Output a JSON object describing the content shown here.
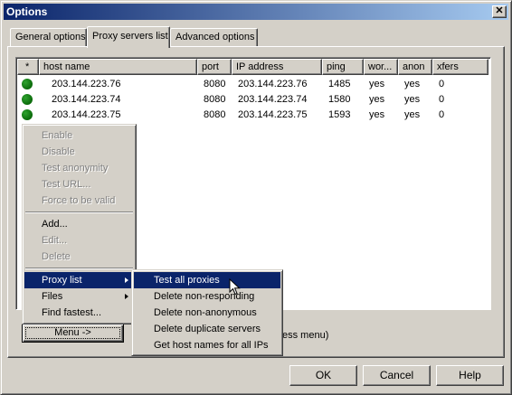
{
  "window": {
    "title": "Options",
    "close_label": "✕"
  },
  "tabs": [
    {
      "label": "General options",
      "active": false
    },
    {
      "label": "Proxy servers list",
      "active": true
    },
    {
      "label": "Advanced options",
      "active": false
    }
  ],
  "table": {
    "columns": [
      "*",
      "host name",
      "port",
      "IP address",
      "ping",
      "wor...",
      "anon",
      "xfers"
    ],
    "rows": [
      {
        "status": "green",
        "host": "203.144.223.76",
        "port": "8080",
        "ip": "203.144.223.76",
        "ping": "1485",
        "wor": "yes",
        "anon": "yes",
        "xfers": "0"
      },
      {
        "status": "green",
        "host": "203.144.223.74",
        "port": "8080",
        "ip": "203.144.223.74",
        "ping": "1580",
        "wor": "yes",
        "anon": "yes",
        "xfers": "0"
      },
      {
        "status": "green",
        "host": "203.144.223.75",
        "port": "8080",
        "ip": "203.144.223.75",
        "ping": "1593",
        "wor": "yes",
        "anon": "yes",
        "xfers": "0"
      }
    ],
    "status_color": "#0a7a0a"
  },
  "context_menu": {
    "items": [
      {
        "label": "Enable",
        "disabled": true
      },
      {
        "label": "Disable",
        "disabled": true
      },
      {
        "label": "Test anonymity",
        "disabled": true
      },
      {
        "label": "Test URL...",
        "disabled": true
      },
      {
        "label": "Force to be valid",
        "disabled": true
      },
      {
        "label": "Add...",
        "disabled": false
      },
      {
        "label": "Edit...",
        "disabled": true
      },
      {
        "label": "Delete",
        "disabled": true
      },
      {
        "label": "Proxy list",
        "disabled": false,
        "submenu": true,
        "highlighted": true
      },
      {
        "label": "Files",
        "disabled": false,
        "submenu": true
      },
      {
        "label": "Find fastest...",
        "disabled": false
      }
    ]
  },
  "submenu": {
    "items": [
      {
        "label": "Test all proxies",
        "highlighted": true
      },
      {
        "label": "Delete non-responding"
      },
      {
        "label": "Delete non-anonymous"
      },
      {
        "label": "Delete duplicate servers"
      },
      {
        "label": "Get host names for all IPs"
      }
    ]
  },
  "menu_button": {
    "label": "Menu ->"
  },
  "partial_text": "ess menu)",
  "buttons": {
    "ok": "OK",
    "cancel": "Cancel",
    "help": "Help"
  },
  "colors": {
    "face": "#d4d0c8",
    "highlight": "#0a246a",
    "title_start": "#0a246a",
    "title_end": "#a6caf0"
  }
}
